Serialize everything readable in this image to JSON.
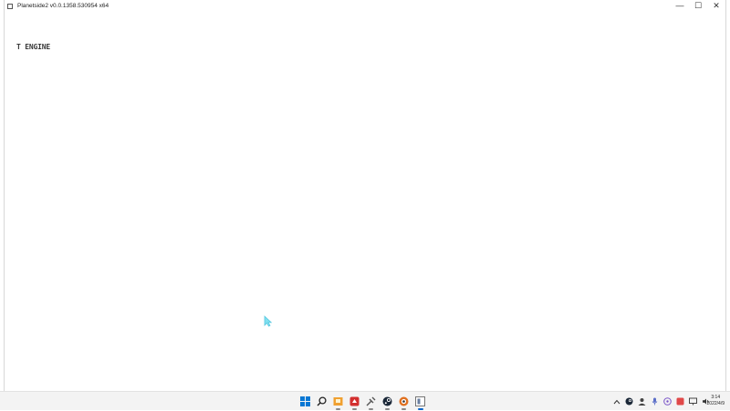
{
  "window": {
    "title": "Planetside2 v0.0.1358.530954 x64",
    "controls": {
      "minimize": "—",
      "maximize": "☐",
      "close": "✕"
    }
  },
  "game": {
    "fps_text": "T ENGINE"
  },
  "taskbar": {
    "apps": [
      {
        "name": "windows-start-icon",
        "active": false,
        "running": false
      },
      {
        "name": "search-icon",
        "active": false,
        "running": false
      },
      {
        "name": "file-explorer-icon",
        "active": false,
        "running": true
      },
      {
        "name": "red-app-icon",
        "active": false,
        "running": true
      },
      {
        "name": "tools-app-icon",
        "active": false,
        "running": true
      },
      {
        "name": "steam-icon",
        "active": false,
        "running": true
      },
      {
        "name": "orange-app-icon",
        "active": false,
        "running": true
      },
      {
        "name": "planetside-app-icon",
        "active": true,
        "running": true
      }
    ],
    "clock": {
      "time": "3:14",
      "date": "2022/4/9"
    },
    "colors": {
      "accent": "#0a64c8",
      "steam": "#1b2838",
      "red": "#d32f2f",
      "orange": "#e07020"
    }
  }
}
